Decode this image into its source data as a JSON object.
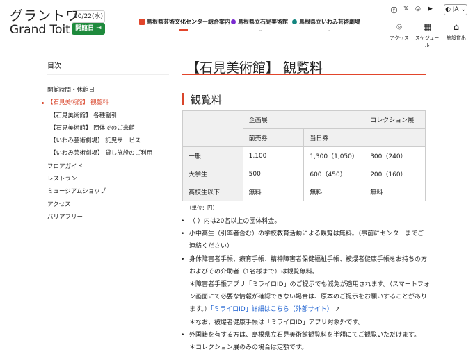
{
  "header": {
    "logo_jp": "グラントワ",
    "logo_en": "Grand Toit",
    "date": "10/22(水)",
    "open_label": "開館日",
    "open_icon": "arrow-right-box-icon",
    "nav": [
      {
        "label": "島根県芸術文化センター総合案内",
        "color": "#e2452b"
      },
      {
        "label": "島根県立石見美術館",
        "color": "#7a2bd0"
      },
      {
        "label": "島根県立いわみ芸術劇場",
        "color": "#13857f"
      }
    ],
    "social": [
      "facebook-icon",
      "x-icon",
      "instagram-icon",
      "youtube-icon"
    ],
    "lang": "JA",
    "utility": [
      {
        "label": "アクセス",
        "icon": "map-pin-icon"
      },
      {
        "label": "スケジュール",
        "icon": "calendar-icon"
      },
      {
        "label": "施設貸出",
        "icon": "house-icon"
      }
    ]
  },
  "sidebar": {
    "title": "目次",
    "items": [
      {
        "label": "開館時間・休館日"
      },
      {
        "label": "【石見美術館】 観覧料",
        "active": true
      },
      {
        "label": "【石見美術館】 各種割引"
      },
      {
        "label": "【石見美術館】 団体でのご来館"
      },
      {
        "label": "【いわみ芸術劇場】 託児サービス"
      },
      {
        "label": "【いわみ芸術劇場】 貸し施設のご利用"
      },
      {
        "label": "フロアガイド"
      },
      {
        "label": "レストラン"
      },
      {
        "label": "ミュージアムショップ"
      },
      {
        "label": "アクセス"
      },
      {
        "label": "バリアフリー"
      }
    ]
  },
  "main": {
    "title": "【石見美術館】 観覧料",
    "section": "観覧料",
    "table": {
      "h1": [
        "企画展",
        "コレクション展"
      ],
      "h2": [
        "前売券",
        "当日券"
      ],
      "rows": [
        [
          "一般",
          "1,100",
          "1,300（1,050）",
          "300（240）"
        ],
        [
          "大学生",
          "500",
          "600（450）",
          "200（160）"
        ],
        [
          "高校生以下",
          "無料",
          "無料",
          "無料"
        ]
      ]
    },
    "unit": "（単位：円）",
    "bullets": [
      "（ ）内は20名以上の団体料金。",
      "小中高生（引率者含む）の学校教育活動による観覧は無料。（事前にセンターまでご連絡ください）",
      "身体障害者手帳、療育手帳、精神障害者保健福祉手帳、被爆者健康手帳をお持ちの方およびその介助者（1名様まで）は観覧無料。",
      "＊障害者手帳アプリ「ミライロID」のご提示でも減免が適用されます。（スマートフォン画面にて必要な情報が確認できない場合は、原本のご提示をお願いすることがあります。）",
      "「ミライロID」詳細はこちら（外部サイト）",
      "＊なお、被爆者健康手帳は「ミライロID」アプリ対象外です。",
      "外国籍を有する方は、島根県立石見美術館観覧料を半額にてご観覧いただけます。",
      "＊コレクション展のみの場合は定額です。"
    ]
  }
}
